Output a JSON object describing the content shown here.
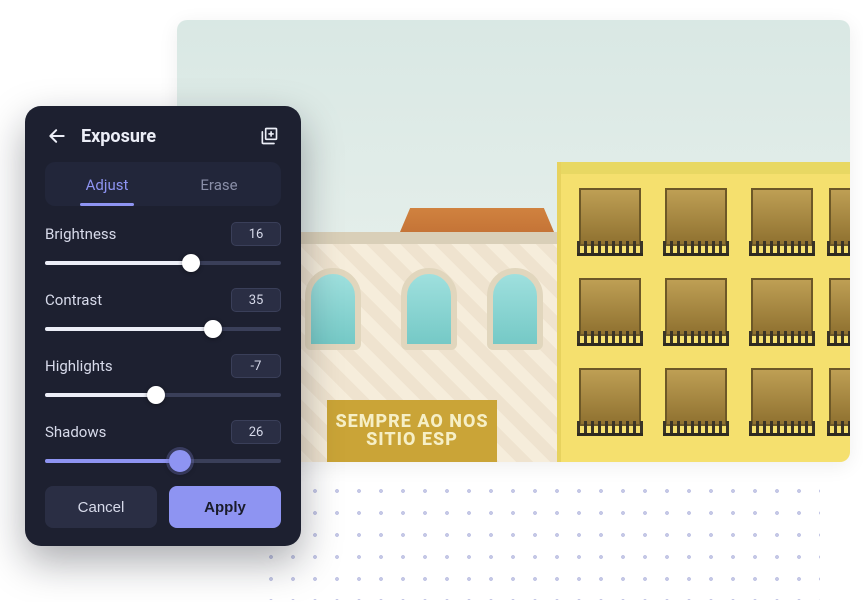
{
  "panel": {
    "title": "Exposure",
    "tabs": {
      "adjust": "Adjust",
      "erase": "Erase",
      "active": "adjust"
    },
    "controls": {
      "brightness": {
        "label": "Brightness",
        "value": 16,
        "percent": 62
      },
      "contrast": {
        "label": "Contrast",
        "value": 35,
        "percent": 71
      },
      "highlights": {
        "label": "Highlights",
        "value": -7,
        "percent": 47
      },
      "shadows": {
        "label": "Shadows",
        "value": 26,
        "percent": 57,
        "accent": true
      }
    },
    "buttons": {
      "cancel": "Cancel",
      "apply": "Apply"
    }
  },
  "image": {
    "sign_text": "SEMPRE AO NOS SITIO ESP"
  },
  "icons": {
    "back": "back-arrow-icon",
    "layers": "layers-icon"
  }
}
